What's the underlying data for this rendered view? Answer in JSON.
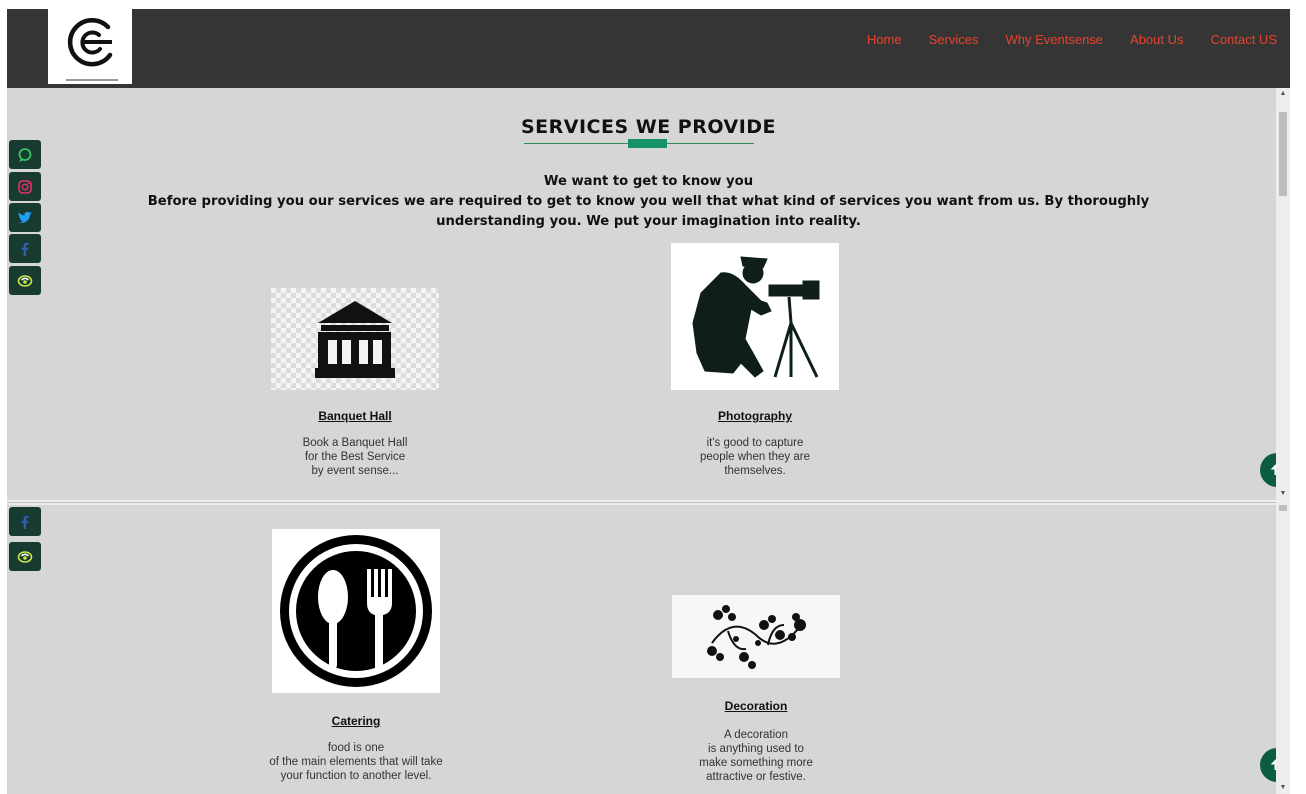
{
  "nav": {
    "items": [
      {
        "label": "Home"
      },
      {
        "label": "Services"
      },
      {
        "label": "Why Eventsense"
      },
      {
        "label": "About Us"
      },
      {
        "label": "Contact US"
      }
    ]
  },
  "services": {
    "title": "SERVICES WE PROVIDE",
    "intro_heading": "We want to get to know you",
    "intro_body": "Before providing you our services we are required to get to know you well that what kind of services you want from us. By thoroughly understanding you. We put your imagination into reality.",
    "cards": [
      {
        "title": "Banquet Hall",
        "desc": "Book a Banquet Hall\nfor the Best Service\nby event sense..."
      },
      {
        "title": "Photography",
        "desc": "it's good to capture\npeople when they are\nthemselves."
      },
      {
        "title": "Catering",
        "desc": "food is one\nof the main elements that will take\nyour function to another level."
      },
      {
        "title": "Decoration",
        "desc": "A decoration\nis anything used to\nmake something more\nattractive or festive."
      }
    ]
  },
  "social": [
    "whatsapp-icon",
    "instagram-icon",
    "twitter-icon",
    "facebook-icon",
    "phone-icon"
  ],
  "colors": {
    "nav_bg": "#353535",
    "nav_link": "#e8422c",
    "page_bg": "#d6d6d6",
    "accent": "#14936b",
    "social_bg": "#173b30"
  }
}
